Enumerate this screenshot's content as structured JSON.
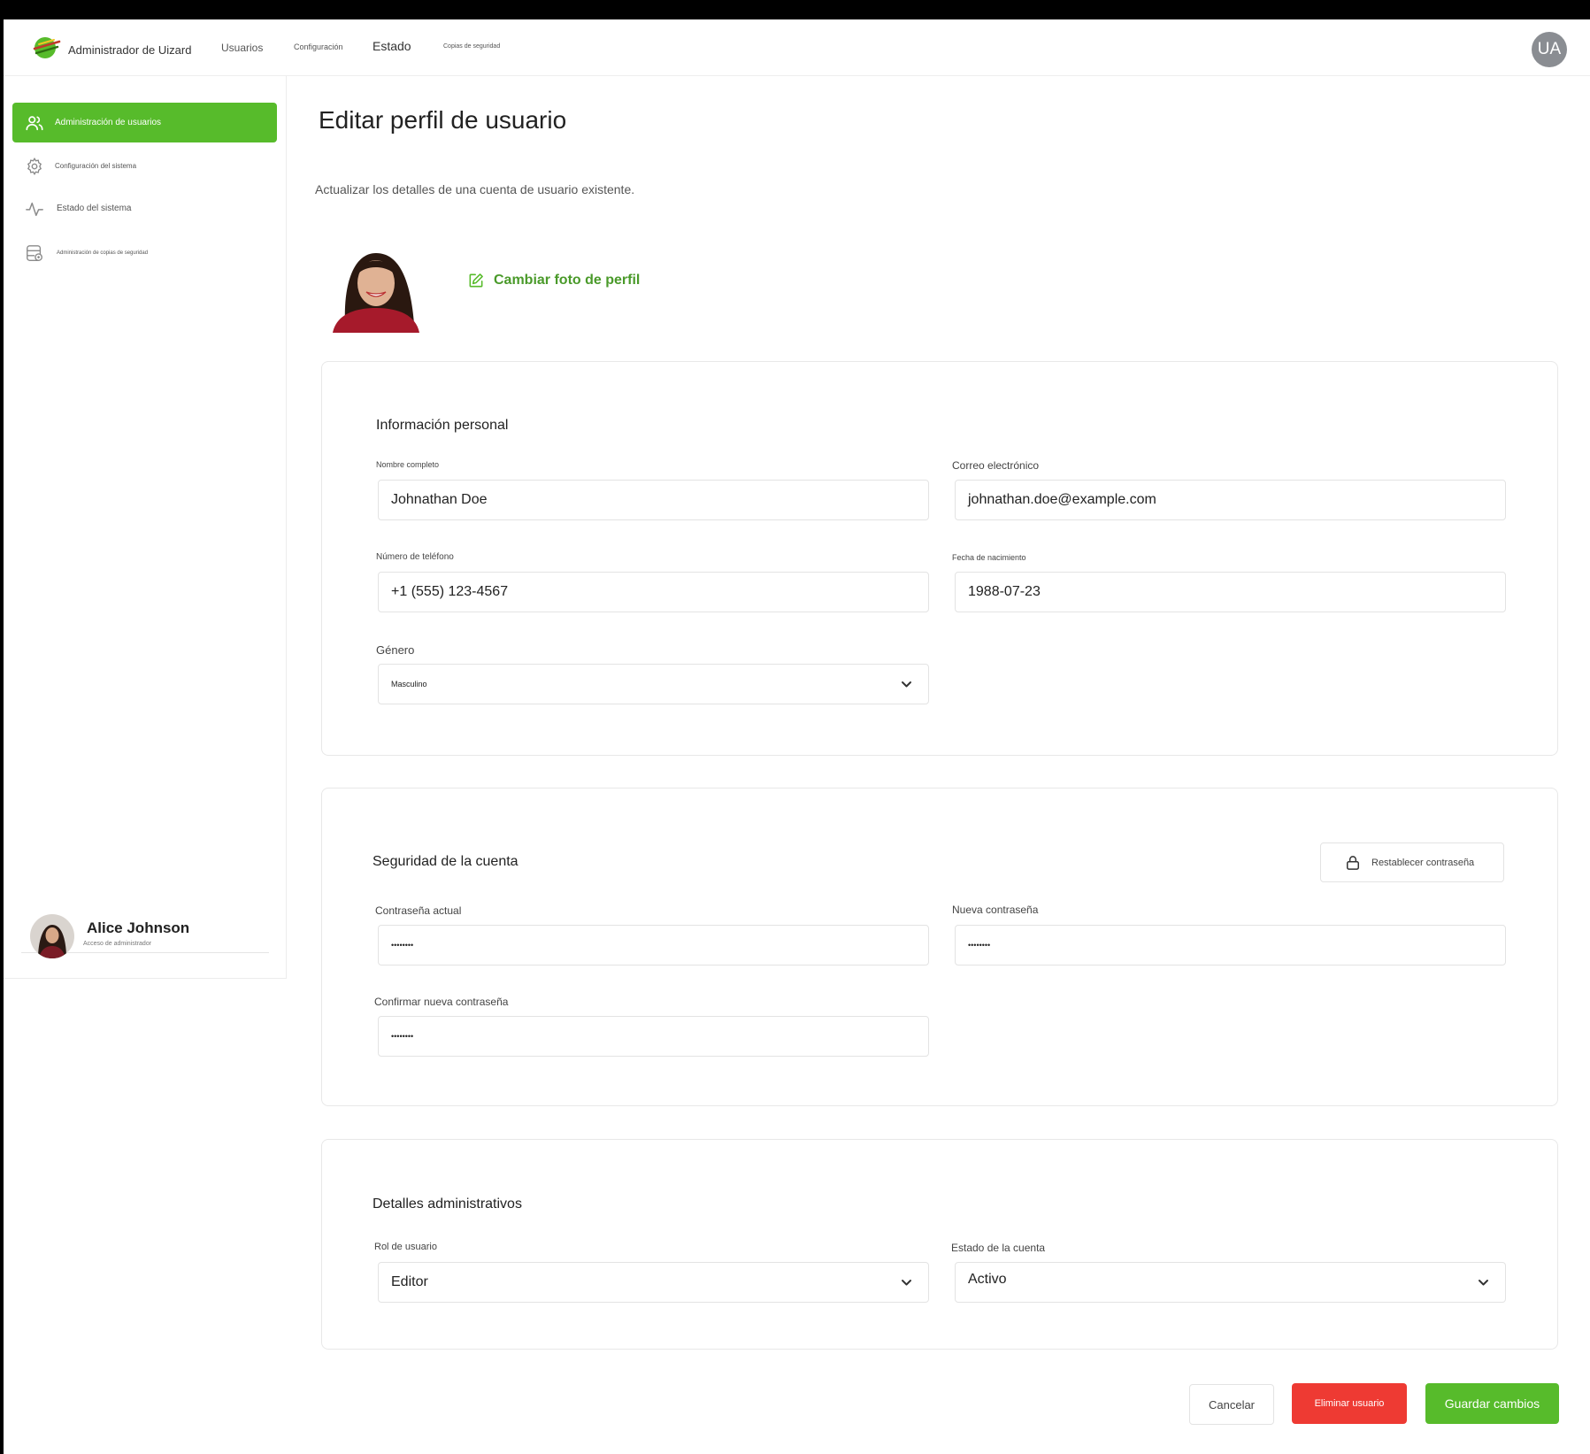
{
  "header": {
    "brand": "Administrador de Uizard",
    "nav": [
      "Usuarios",
      "Configuración",
      "Estado",
      "Copias de seguridad"
    ],
    "avatar_initials": "UA"
  },
  "sidebar": {
    "items": [
      {
        "label": "Administración de usuarios",
        "icon": "users-icon",
        "active": true
      },
      {
        "label": "Configuración del sistema",
        "icon": "gear-icon",
        "active": false
      },
      {
        "label": "Estado del sistema",
        "icon": "activity-icon",
        "active": false
      },
      {
        "label": "Administración de copias de seguridad",
        "icon": "database-icon",
        "active": false
      }
    ],
    "user": {
      "name": "Alice Johnson",
      "role": "Acceso de administrador"
    }
  },
  "page": {
    "title": "Editar perfil de usuario",
    "subtitle": "Actualizar los detalles de una cuenta de usuario existente.",
    "change_photo": "Cambiar foto de perfil"
  },
  "personal": {
    "title": "Información personal",
    "full_name_label": "Nombre completo",
    "full_name": "Johnathan Doe",
    "email_label": "Correo electrónico",
    "email": "johnathan.doe@example.com",
    "phone_label": "Número de teléfono",
    "phone": "+1 (555) 123-4567",
    "birth_label": "Fecha de nacimiento",
    "birth": "1988-07-23",
    "gender_label": "Género",
    "gender": "Masculino"
  },
  "security": {
    "title": "Seguridad de la cuenta",
    "reset_label": "Restablecer contraseña",
    "current_label": "Contraseña actual",
    "current": "••••••••",
    "new_label": "Nueva contraseña",
    "new": "••••••••",
    "confirm_label": "Confirmar nueva contraseña",
    "confirm": "••••••••"
  },
  "admin": {
    "title": "Detalles administrativos",
    "role_label": "Rol de usuario",
    "role": "Editor",
    "status_label": "Estado de la cuenta",
    "status": "Activo"
  },
  "actions": {
    "cancel": "Cancelar",
    "delete": "Eliminar usuario",
    "save": "Guardar cambios"
  },
  "colors": {
    "accent": "#57bb2b",
    "danger": "#ee3a33"
  }
}
